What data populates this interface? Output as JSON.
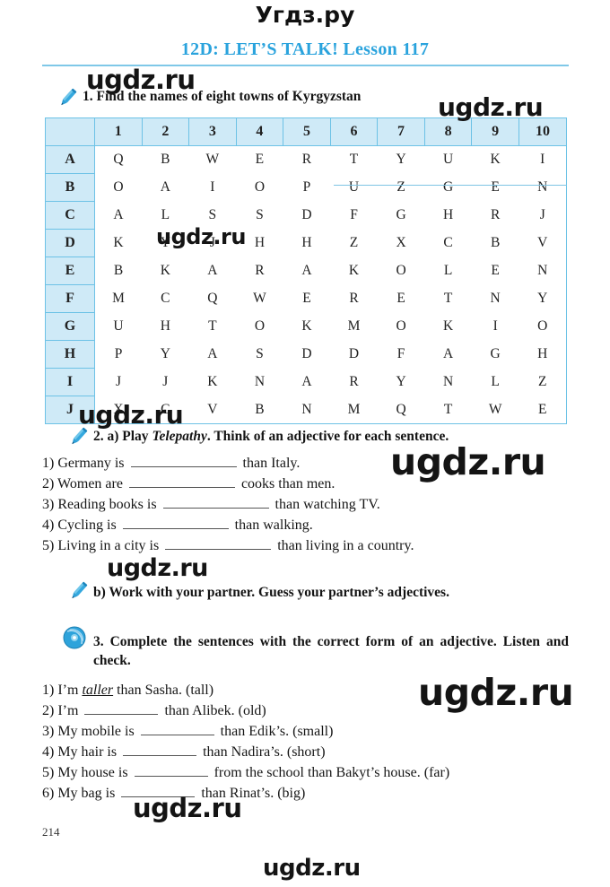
{
  "site": {
    "top_title": "Угдз.ру",
    "watermark": "ugdz.ru"
  },
  "header": {
    "lesson_title": "12D: LET’S TALK! Lesson 117"
  },
  "exercise1": {
    "icon": "pen-icon",
    "heading": "1. Find the names of eight towns of Kyrgyzstan",
    "grid": {
      "col_headers": [
        "1",
        "2",
        "3",
        "4",
        "5",
        "6",
        "7",
        "8",
        "9",
        "10"
      ],
      "row_headers": [
        "A",
        "B",
        "C",
        "D",
        "E",
        "F",
        "G",
        "H",
        "I",
        "J"
      ],
      "rows": [
        [
          "Q",
          "B",
          "W",
          "E",
          "R",
          "T",
          "Y",
          "U",
          "K",
          "I"
        ],
        [
          "O",
          "A",
          "I",
          "O",
          "P",
          "U",
          "Z",
          "G",
          "E",
          "N"
        ],
        [
          "A",
          "L",
          "S",
          "S",
          "D",
          "F",
          "G",
          "H",
          "R",
          "J"
        ],
        [
          "K",
          "Y",
          "J",
          "H",
          "H",
          "Z",
          "X",
          "C",
          "B",
          "V"
        ],
        [
          "B",
          "K",
          "A",
          "R",
          "A",
          "K",
          "O",
          "L",
          "E",
          "N"
        ],
        [
          "M",
          "C",
          "Q",
          "W",
          "E",
          "R",
          "E",
          "T",
          "N",
          "Y"
        ],
        [
          "U",
          "H",
          "T",
          "O",
          "K",
          "M",
          "O",
          "K",
          "I",
          "O"
        ],
        [
          "P",
          "Y",
          "A",
          "S",
          "D",
          "D",
          "F",
          "A",
          "G",
          "H"
        ],
        [
          "J",
          "J",
          "K",
          "N",
          "A",
          "R",
          "Y",
          "N",
          "L",
          "Z"
        ],
        [
          "X",
          "C",
          "V",
          "B",
          "N",
          "M",
          "Q",
          "T",
          "W",
          "E"
        ]
      ],
      "found_word": "UZGEN",
      "strike_color": "#7ec4e4"
    }
  },
  "exercise2a": {
    "icon": "pen-icon",
    "heading_prefix": "2. a) Play ",
    "heading_italic": "Telepathy",
    "heading_suffix": ". Think of an adjective for each sentence.",
    "sentences": [
      {
        "num": "1)",
        "before": "Germany is",
        "blank": 118,
        "after": "than Italy."
      },
      {
        "num": "2)",
        "before": "Women are",
        "blank": 118,
        "after": "cooks than men."
      },
      {
        "num": "3)",
        "before": "Reading books is",
        "blank": 118,
        "after": "than watching TV."
      },
      {
        "num": "4)",
        "before": "Cycling is",
        "blank": 118,
        "after": "than walking."
      },
      {
        "num": "5)",
        "before": "Living in a city is",
        "blank": 118,
        "after": "than living in a country."
      }
    ]
  },
  "exercise2b": {
    "icon": "pen-icon",
    "heading": "b) Work with your partner. Guess your partner’s adjectives."
  },
  "exercise3": {
    "icon": "cd-icon",
    "heading": "3. Complete the sentences with the correct form of an adjective. Listen and check.",
    "sentences": [
      {
        "num": "1)",
        "before": "I’m",
        "answer": "taller",
        "blank": 0,
        "after": "than Sasha. (tall)"
      },
      {
        "num": "2)",
        "before": "I’m",
        "answer": "",
        "blank": 82,
        "after": "than Alibek. (old)"
      },
      {
        "num": "3)",
        "before": "My mobile is",
        "answer": "",
        "blank": 82,
        "after": "than Edik’s. (small)"
      },
      {
        "num": "4)",
        "before": "My hair is",
        "answer": "",
        "blank": 82,
        "after": "than Nadira’s. (short)"
      },
      {
        "num": "5)",
        "before": "My house is",
        "answer": "",
        "blank": 82,
        "after": "from the school than Bakyt’s house. (far)"
      },
      {
        "num": "6)",
        "before": "My bag is",
        "answer": "",
        "blank": 82,
        "after": "than Rinat’s. (big)"
      }
    ]
  },
  "footer": {
    "page_number": "214"
  },
  "colors": {
    "title_blue": "#2aa3dd",
    "grid_border": "#6dc2e6",
    "grid_header_fill": "#cfeaf7",
    "icon_blue": "#29a3db"
  }
}
